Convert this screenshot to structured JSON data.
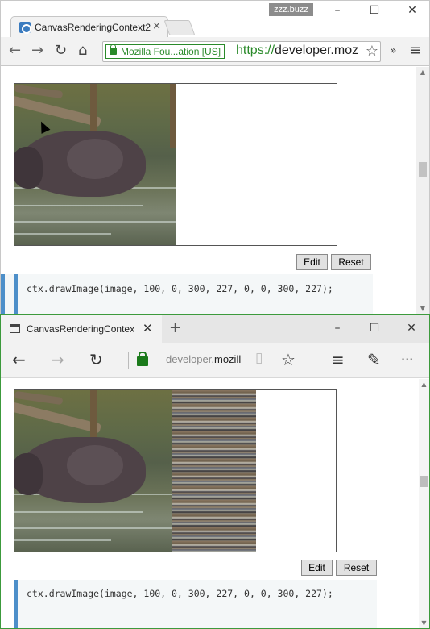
{
  "chrome": {
    "tab_title": "CanvasRenderingContext2",
    "tab_close": "×",
    "profile": "zzz.buzz",
    "win_min": "–",
    "win_max": "☐",
    "win_close": "✕",
    "nav_back": "←",
    "nav_forward": "→",
    "nav_reload": "↻",
    "nav_home": "⌂",
    "ev_cert": "Mozilla Fou...ation [US]",
    "url_scheme": "https://",
    "url_host": "developer.moz",
    "bookmark_star": "☆",
    "extensions": "»",
    "menu": "≡",
    "edit_label": "Edit",
    "reset_label": "Reset",
    "code": "ctx.drawImage(image, 100, 0, 300, 227, 0, 0, 300, 227);"
  },
  "edge": {
    "tab_title": "CanvasRenderingContex",
    "tab_close": "✕",
    "new_tab": "+",
    "win_min": "–",
    "win_max": "☐",
    "win_close": "✕",
    "nav_back": "←",
    "nav_forward": "→",
    "nav_refresh": "↻",
    "addr_prefix": "developer.",
    "addr_domain": "mozill",
    "reading_view": "▯",
    "favorite": "☆",
    "hub": "≡",
    "web_note": "✎",
    "more": "···",
    "edit_label": "Edit",
    "reset_label": "Reset",
    "code": "ctx.drawImage(image, 100, 0, 300, 227, 0, 0, 300, 227);"
  },
  "colors": {
    "ev_green": "#2a8a2a",
    "code_border": "#4d8fc9",
    "edge_frame": "#3c9a3c"
  }
}
